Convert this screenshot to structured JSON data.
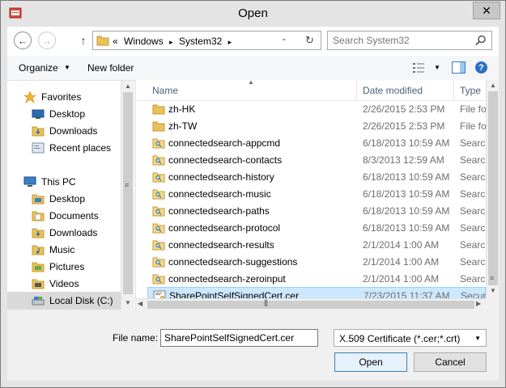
{
  "window": {
    "title": "Open",
    "close_glyph": "✕"
  },
  "address": {
    "path_prefix": "«",
    "segments": [
      "Windows",
      "System32"
    ],
    "separator": "▸",
    "search_placeholder": "Search System32"
  },
  "toolbar": {
    "organize_label": "Organize",
    "new_folder_label": "New folder"
  },
  "nav": {
    "favorites_label": "Favorites",
    "favorites": [
      {
        "label": "Desktop",
        "icon": "desktop-icon"
      },
      {
        "label": "Downloads",
        "icon": "downloads-folder-icon"
      },
      {
        "label": "Recent places",
        "icon": "recent-places-icon"
      }
    ],
    "this_pc_label": "This PC",
    "this_pc": [
      {
        "label": "Desktop",
        "icon": "folder-icon"
      },
      {
        "label": "Documents",
        "icon": "folder-icon"
      },
      {
        "label": "Downloads",
        "icon": "folder-icon"
      },
      {
        "label": "Music",
        "icon": "folder-icon"
      },
      {
        "label": "Pictures",
        "icon": "folder-icon"
      },
      {
        "label": "Videos",
        "icon": "folder-icon"
      },
      {
        "label": "Local Disk (C:)",
        "icon": "local-disk-icon"
      }
    ],
    "selected": "Local Disk (C:)"
  },
  "columns": {
    "name": "Name",
    "date": "Date modified",
    "type": "Type"
  },
  "files": [
    {
      "name": "zh-HK",
      "date": "2/26/2015 2:53 PM",
      "type": "File fold",
      "icon": "folder-icon"
    },
    {
      "name": "zh-TW",
      "date": "2/26/2015 2:53 PM",
      "type": "File fold",
      "icon": "folder-icon"
    },
    {
      "name": "connectedsearch-appcmd",
      "date": "6/18/2013 10:59 AM",
      "type": "Search",
      "icon": "search-folder-icon"
    },
    {
      "name": "connectedsearch-contacts",
      "date": "8/3/2013 12:59 AM",
      "type": "Search",
      "icon": "search-folder-icon"
    },
    {
      "name": "connectedsearch-history",
      "date": "6/18/2013 10:59 AM",
      "type": "Search",
      "icon": "search-folder-icon"
    },
    {
      "name": "connectedsearch-music",
      "date": "6/18/2013 10:59 AM",
      "type": "Search",
      "icon": "search-folder-icon"
    },
    {
      "name": "connectedsearch-paths",
      "date": "6/18/2013 10:59 AM",
      "type": "Search",
      "icon": "search-folder-icon"
    },
    {
      "name": "connectedsearch-protocol",
      "date": "6/18/2013 10:59 AM",
      "type": "Search",
      "icon": "search-folder-icon"
    },
    {
      "name": "connectedsearch-results",
      "date": "2/1/2014 1:00 AM",
      "type": "Search",
      "icon": "search-folder-icon"
    },
    {
      "name": "connectedsearch-suggestions",
      "date": "2/1/2014 1:00 AM",
      "type": "Search",
      "icon": "search-folder-icon"
    },
    {
      "name": "connectedsearch-zeroinput",
      "date": "2/1/2014 1:00 AM",
      "type": "Search",
      "icon": "search-folder-icon"
    },
    {
      "name": "SharePointSelfSignedCert.cer",
      "date": "7/23/2015 11:37 AM",
      "type": "Securit",
      "icon": "certificate-icon",
      "selected": true
    }
  ],
  "footer": {
    "file_name_label": "File name:",
    "file_name_value": "SharePointSelfSignedCert.cer",
    "file_type_value": "X.509 Certificate (*.cer;*.crt)",
    "open_label": "Open",
    "cancel_label": "Cancel"
  },
  "colors": {
    "selection_bg": "#cce8ff",
    "selection_border": "#99d1ff",
    "header_text": "#4c607a",
    "folder": "#e8c25a"
  }
}
